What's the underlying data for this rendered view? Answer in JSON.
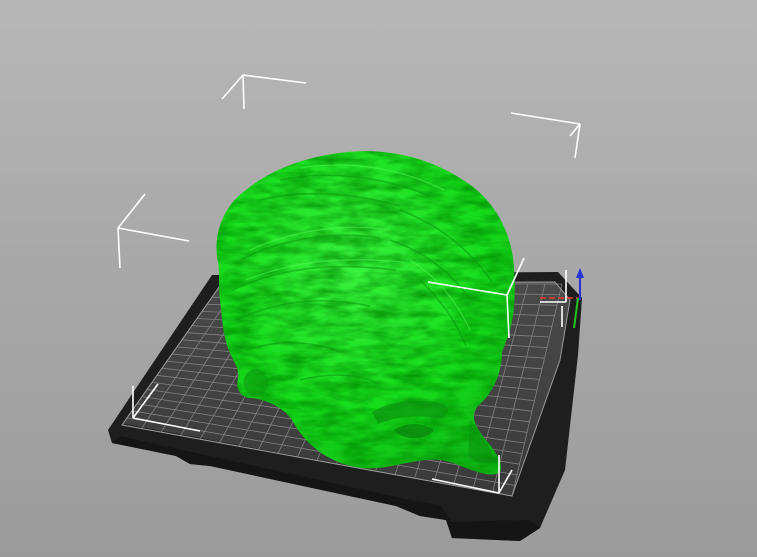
{
  "app": {
    "viewport_background": "#aaaaaa"
  },
  "scene": {
    "model": {
      "kind": "head-sculpture",
      "color": "#14e01b",
      "state": "selected"
    },
    "bed": {
      "surface_color": "#424242",
      "frame_color": "#1f1f1f",
      "grid_color": "#8c8c8c"
    },
    "axes": {
      "x_color": "#e53935",
      "y_color": "#21c421",
      "z_color": "#2432d6"
    },
    "selection_box_color": "#ffffff"
  }
}
